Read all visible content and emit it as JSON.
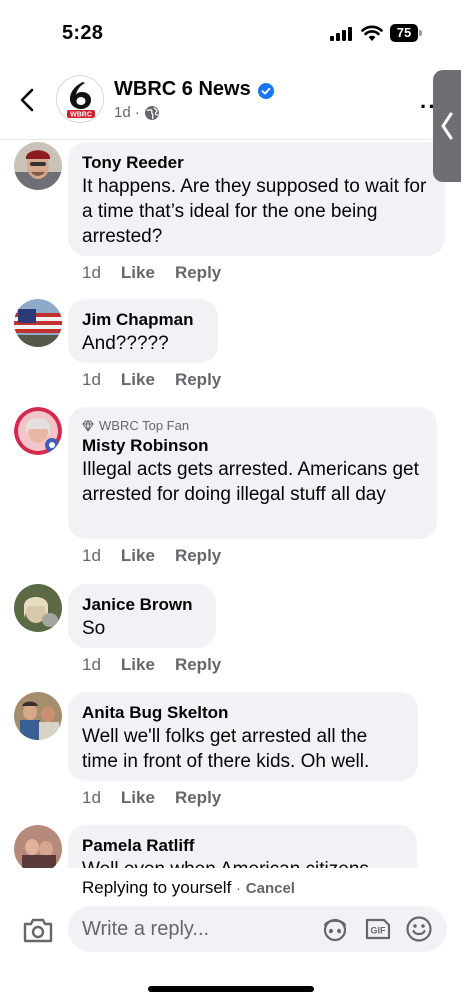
{
  "status_bar": {
    "time": "5:28",
    "battery": "75"
  },
  "header": {
    "page_name": "WBRC 6 News",
    "logo_text": "WBRC",
    "post_age": "1d",
    "meta_separator": "·",
    "more_label": "··"
  },
  "comments": [
    {
      "author": "Tony Reeder",
      "badge": "",
      "text": "It happens. Are they supposed to wait for a time that’s ideal for the one being arrested?",
      "time": "1d",
      "like_label": "Like",
      "reply_label": "Reply"
    },
    {
      "author": "Jim Chapman",
      "badge": "",
      "text": "And?????",
      "time": "1d",
      "like_label": "Like",
      "reply_label": "Reply"
    },
    {
      "author": "Misty Robinson",
      "badge": "WBRC Top Fan",
      "text": "Illegal acts gets arrested. Americans get arrested for doing illegal stuff all day",
      "time": "1d",
      "like_label": "Like",
      "reply_label": "Reply"
    },
    {
      "author": "Janice Brown",
      "badge": "",
      "text": "So",
      "time": "1d",
      "like_label": "Like",
      "reply_label": "Reply"
    },
    {
      "author": "Anita Bug Skelton",
      "badge": "",
      "text": "Well we'll folks get arrested all the time in front of there kids. Oh well.",
      "time": "1d",
      "like_label": "Like",
      "reply_label": "Reply"
    },
    {
      "author": "Pamela Ratliff",
      "badge": "",
      "text": "Well even when American citizens",
      "time": "",
      "like_label": "",
      "reply_label": ""
    }
  ],
  "reply_bar": {
    "replying_text": "Replying to yourself",
    "separator": "·",
    "cancel_label": "Cancel",
    "input_placeholder": "Write a reply..."
  },
  "colors": {
    "bubble_bg": "#f0f2f5",
    "secondary_text": "#65676b",
    "verified_blue": "#1877f2",
    "logo_red": "#d0202e"
  },
  "icons": [
    "back-chevron-icon",
    "verified-badge-icon",
    "globe-icon",
    "more-icon",
    "camera-icon",
    "avatar-sticker-icon",
    "gif-icon",
    "emoji-icon",
    "signal-icon",
    "wifi-icon",
    "battery-icon",
    "diamond-icon"
  ]
}
